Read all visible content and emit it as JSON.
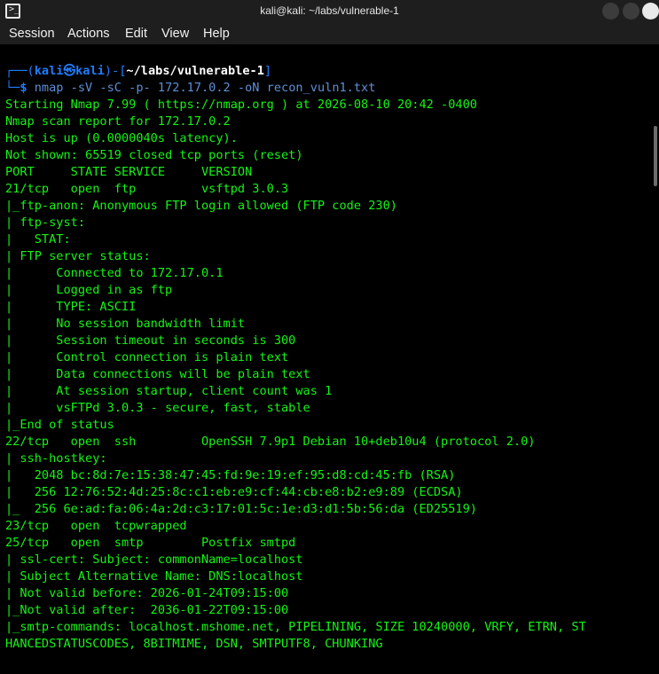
{
  "window": {
    "title": "kali@kali: ~/labs/vulnerable-1"
  },
  "menu": {
    "items": [
      "Session",
      "Actions",
      "Edit",
      "View",
      "Help"
    ]
  },
  "prompt": {
    "user": "kali",
    "at_symbol": "㉿",
    "host": "kali",
    "path": "~/labs/vulnerable-1",
    "symbol": "$",
    "command": "nmap",
    "arguments": " -sV -sC -p- 172.17.0.2 -oN recon_vuln1.txt"
  },
  "output_lines": [
    "Starting Nmap 7.99 ( https://nmap.org ) at 2026-08-10 20:42 -0400",
    "Nmap scan report for 172.17.0.2",
    "Host is up (0.0000040s latency).",
    "Not shown: 65519 closed tcp ports (reset)",
    "PORT     STATE SERVICE     VERSION",
    "21/tcp   open  ftp         vsftpd 3.0.3",
    "|_ftp-anon: Anonymous FTP login allowed (FTP code 230)",
    "| ftp-syst:",
    "|   STAT:",
    "| FTP server status:",
    "|      Connected to 172.17.0.1",
    "|      Logged in as ftp",
    "|      TYPE: ASCII",
    "|      No session bandwidth limit",
    "|      Session timeout in seconds is 300",
    "|      Control connection is plain text",
    "|      Data connections will be plain text",
    "|      At session startup, client count was 1",
    "|      vsFTPd 3.0.3 - secure, fast, stable",
    "|_End of status",
    "22/tcp   open  ssh         OpenSSH 7.9p1 Debian 10+deb10u4 (protocol 2.0)",
    "| ssh-hostkey:",
    "|   2048 bc:8d:7e:15:38:47:45:fd:9e:19:ef:95:d8:cd:45:fb (RSA)",
    "|   256 12:76:52:4d:25:8c:c1:eb:e9:cf:44:cb:e8:b2:e9:89 (ECDSA)",
    "|_  256 6e:ad:fa:06:4a:2d:c3:17:01:5c:1e:d3:d1:5b:56:da (ED25519)",
    "23/tcp   open  tcpwrapped",
    "25/tcp   open  smtp        Postfix smtpd",
    "| ssl-cert: Subject: commonName=localhost",
    "| Subject Alternative Name: DNS:localhost",
    "| Not valid before: 2026-01-24T09:15:00",
    "|_Not valid after:  2036-01-22T09:15:00",
    "|_smtp-commands: localhost.mshome.net, PIPELINING, SIZE 10240000, VRFY, ETRN, ST",
    "HANCEDSTATUSCODES, 8BITMIME, DSN, SMTPUTF8, CHUNKING"
  ],
  "icons": {
    "app": "terminal-icon",
    "minimize": "minimize-icon",
    "maximize": "maximize-icon",
    "close": "close-icon"
  },
  "colors": {
    "output_text": "#15f315",
    "prompt_blue": "#1e7dff",
    "background": "#000000",
    "chrome": "#1e1e1e"
  }
}
